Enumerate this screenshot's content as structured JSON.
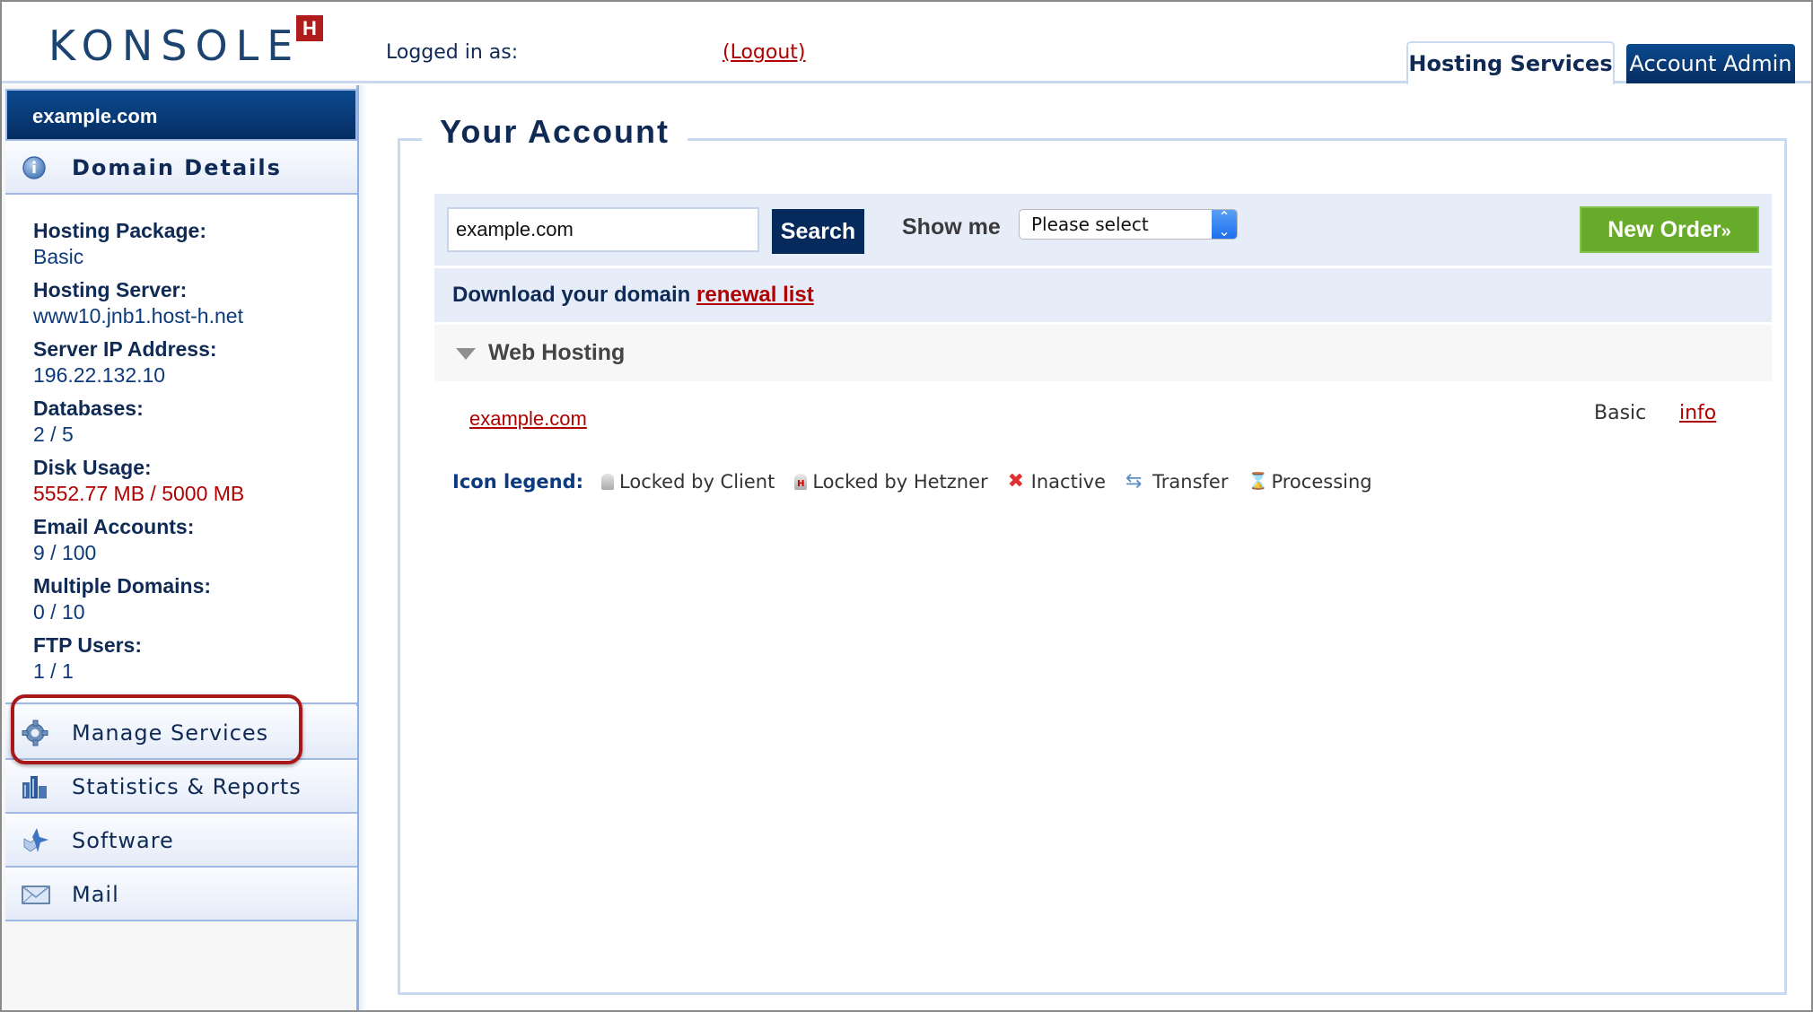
{
  "header": {
    "logo_text": "KONSOLE",
    "logo_badge": "H",
    "logged_in_label": "Logged in as:",
    "logout_label": "(Logout)",
    "tabs": [
      {
        "label": "Hosting Services",
        "active": true
      },
      {
        "label": "Account Admin",
        "active": false
      }
    ]
  },
  "sidebar": {
    "domain": "example.com",
    "details_header": "Domain Details",
    "details": [
      {
        "label": "Hosting Package:",
        "value": "Basic"
      },
      {
        "label": "Hosting Server:",
        "value": "www10.jnb1.host-h.net"
      },
      {
        "label": "Server IP Address:",
        "value": "196.22.132.10"
      },
      {
        "label": "Databases:",
        "value": "2 / 5"
      },
      {
        "label": "Disk Usage:",
        "value": "5552.77 MB / 5000 MB",
        "warning": true
      },
      {
        "label": "Email Accounts:",
        "value": "9 / 100"
      },
      {
        "label": "Multiple Domains:",
        "value": "0 / 10"
      },
      {
        "label": "FTP Users:",
        "value": "1 / 1"
      }
    ],
    "nav": [
      {
        "label": "Manage Services",
        "icon": "gear-icon",
        "highlighted": true
      },
      {
        "label": "Statistics & Reports",
        "icon": "bar-chart-icon"
      },
      {
        "label": "Software",
        "icon": "software-icon"
      },
      {
        "label": "Mail",
        "icon": "envelope-icon"
      }
    ]
  },
  "main": {
    "title": "Your Account",
    "search": {
      "value": "example.com",
      "button_label": "Search"
    },
    "show_me": {
      "label": "Show me",
      "selected": "Please select"
    },
    "new_order_label": "New Order",
    "new_order_suffix": "»",
    "download": {
      "text": "Download your domain",
      "link_label": "renewal list"
    },
    "section": {
      "label": "Web Hosting",
      "rows": [
        {
          "domain": "example.com",
          "package": "Basic",
          "action": "info"
        }
      ]
    },
    "icon_legend": {
      "title": "Icon legend:",
      "items": [
        {
          "icon": "lock-client-icon",
          "label": "Locked by Client"
        },
        {
          "icon": "lock-hetzner-icon",
          "label": "Locked by Hetzner"
        },
        {
          "icon": "inactive-x-icon",
          "label": "Inactive"
        },
        {
          "icon": "transfer-icon",
          "label": "Transfer"
        },
        {
          "icon": "hourglass-icon",
          "label": "Processing"
        }
      ]
    }
  },
  "colors": {
    "brand_navy": "#062d62",
    "link_red": "#b00000",
    "new_order_green": "#68ab2a",
    "panel_border": "#c9d9f2",
    "row_bg": "#e6edf9"
  }
}
